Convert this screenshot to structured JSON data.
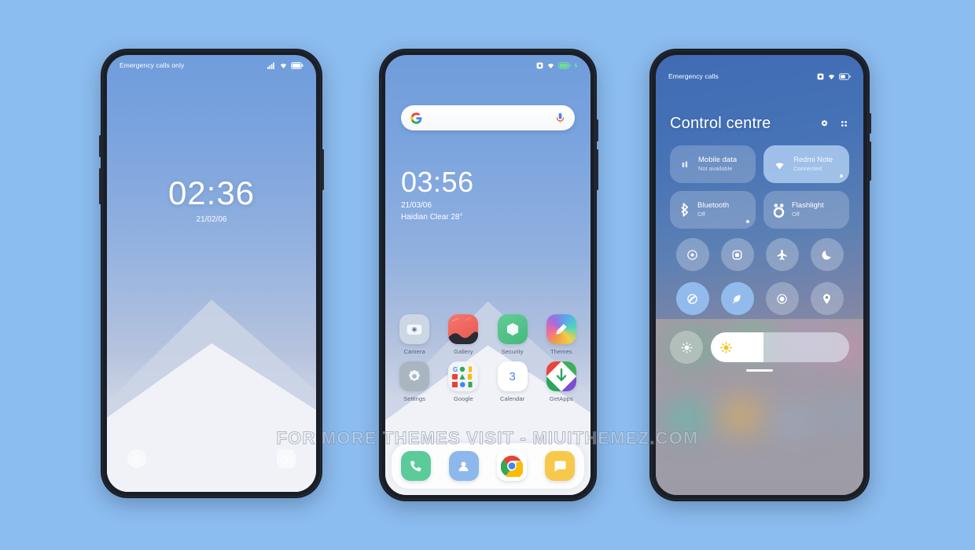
{
  "background_color": "#8cbdf0",
  "watermark": {
    "text": "FOR MORE THEMES VISIT - MIUITHEMEZ.COM"
  },
  "phones": {
    "lock_screen": {
      "status_bar": {
        "carrier": "Emergency calls only",
        "icons": [
          "signal-icon",
          "wifi-icon",
          "battery-icon"
        ]
      },
      "clock": {
        "time": "02:36",
        "date": "21/02/06"
      },
      "shortcuts": [
        {
          "name": "flashlight-shortcut",
          "icon": "flashlight-icon"
        },
        {
          "name": "camera-shortcut",
          "icon": "camera-icon"
        }
      ]
    },
    "home_screen": {
      "status_bar": {
        "carrier": "",
        "icons": [
          "alarm-icon",
          "wifi-icon",
          "battery-icon",
          "charging-bolt-icon"
        ]
      },
      "search": {
        "placeholder": "",
        "value": "",
        "leading_icon": "google-g-icon",
        "trailing_icon": "microphone-icon"
      },
      "clock": {
        "time": "03:56",
        "date": "21/03/06",
        "weather": "Haidian Clear 28°"
      },
      "apps": [
        {
          "label": "Camera",
          "icon": "camera-icon",
          "bg": "#cfd9e6"
        },
        {
          "label": "Gallery",
          "icon": "gallery-icon",
          "bg": "#f0665e"
        },
        {
          "label": "Security",
          "icon": "security-icon",
          "bg": "#54c28a"
        },
        {
          "label": "Themes",
          "icon": "themes-icon",
          "bg": "#c58ad8"
        },
        {
          "label": "Settings",
          "icon": "settings-icon",
          "bg": "#aab6c2"
        },
        {
          "label": "Google",
          "icon": "google-folder-icon",
          "bg": "#f3f5f8"
        },
        {
          "label": "Calendar",
          "icon": "calendar-icon",
          "bg": "#ffffff",
          "day": "3"
        },
        {
          "label": "GetApps",
          "icon": "getapps-icon",
          "bg": "#ffffff"
        }
      ],
      "dock": [
        {
          "label": "Phone",
          "icon": "phone-icon",
          "bg": "#5ccb9a"
        },
        {
          "label": "Contacts",
          "icon": "contacts-icon",
          "bg": "#8db8ec"
        },
        {
          "label": "Chrome",
          "icon": "chrome-icon",
          "bg": "#ffffff"
        },
        {
          "label": "Messages",
          "icon": "messages-icon",
          "bg": "#f7c94b"
        }
      ]
    },
    "control_centre": {
      "status_bar": {
        "carrier": "Emergency calls",
        "icons": [
          "alarm-icon",
          "wifi-icon",
          "battery-icon"
        ]
      },
      "title": "Control centre",
      "title_icons": [
        "settings-gear-icon",
        "edit-grid-icon"
      ],
      "big_tiles": [
        {
          "title": "Mobile data",
          "subtitle": "Not available",
          "icon": "mobile-data-icon",
          "state": "off"
        },
        {
          "title": "Redmi Note",
          "subtitle": "Connected",
          "icon": "wifi-icon",
          "state": "on"
        },
        {
          "title": "Bluetooth",
          "subtitle": "Off",
          "icon": "bluetooth-icon",
          "state": "off"
        },
        {
          "title": "Flashlight",
          "subtitle": "Off",
          "icon": "flashlight-icon",
          "state": "off"
        }
      ],
      "toggles": [
        {
          "name": "auto-rotate-icon",
          "state": "off"
        },
        {
          "name": "screenshot-icon",
          "state": "off"
        },
        {
          "name": "airplane-mode-icon",
          "state": "off"
        },
        {
          "name": "dark-mode-icon",
          "state": "off"
        },
        {
          "name": "do-not-disturb-icon",
          "state": "on"
        },
        {
          "name": "location-leaf-icon",
          "state": "on"
        },
        {
          "name": "screen-record-icon",
          "state": "off"
        },
        {
          "name": "location-pin-icon",
          "state": "off"
        }
      ],
      "brightness": {
        "auto_icon": "auto-brightness-icon",
        "slider_icon": "sun-icon",
        "level_percent": 38
      }
    }
  }
}
